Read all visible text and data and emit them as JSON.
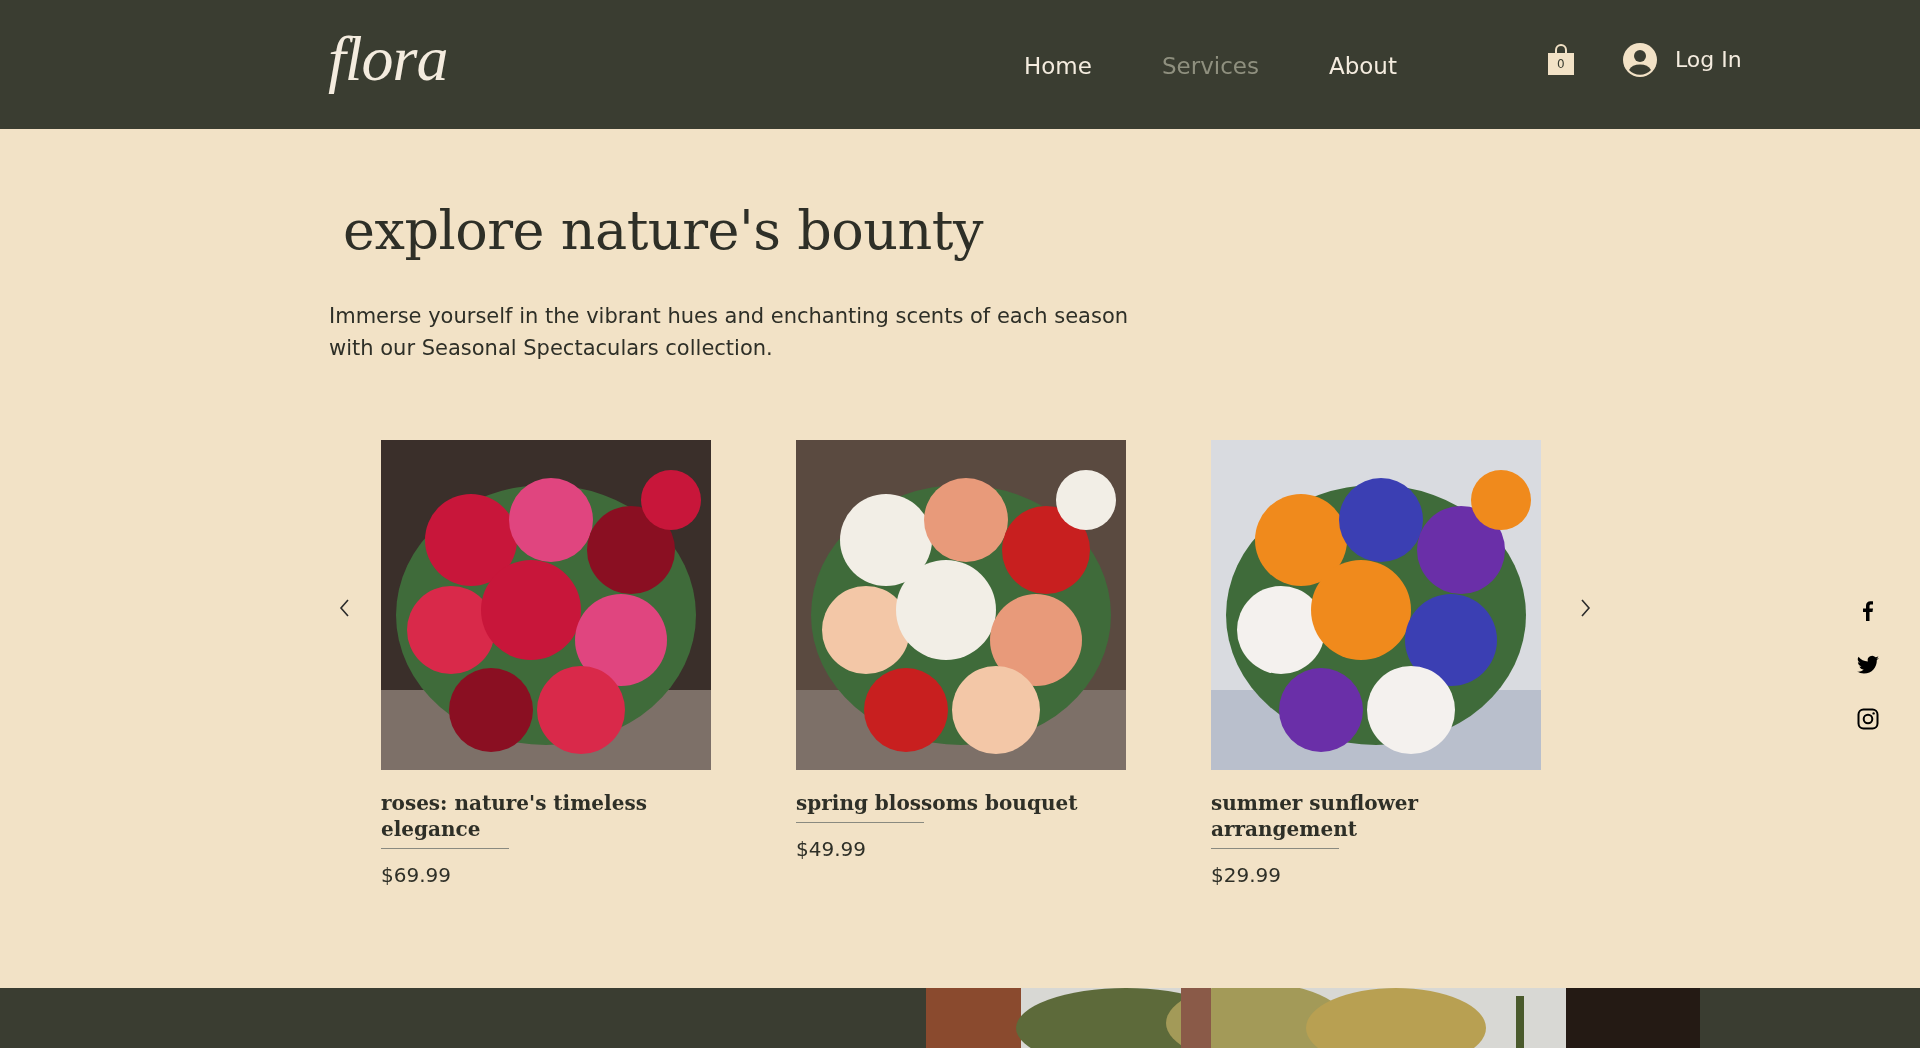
{
  "header": {
    "logo": "flora",
    "nav": [
      {
        "label": "Home",
        "selected": false
      },
      {
        "label": "Services",
        "selected": true
      },
      {
        "label": "About",
        "selected": false
      }
    ],
    "cart_count": "0",
    "login": "Log In"
  },
  "hero": {
    "title": "explore nature's bounty",
    "text": "Immerse yourself in the vibrant hues and enchanting scents of each season with our Seasonal Spectaculars collection."
  },
  "products": [
    {
      "name": "roses: nature's timeless elegance",
      "price": "$69.99"
    },
    {
      "name": "spring blossoms bouquet",
      "price": "$49.99"
    },
    {
      "name": "summer sunflower arrangement",
      "price": "$29.99"
    }
  ],
  "social": [
    {
      "kind": "facebook"
    },
    {
      "kind": "twitter"
    },
    {
      "kind": "instagram"
    }
  ]
}
